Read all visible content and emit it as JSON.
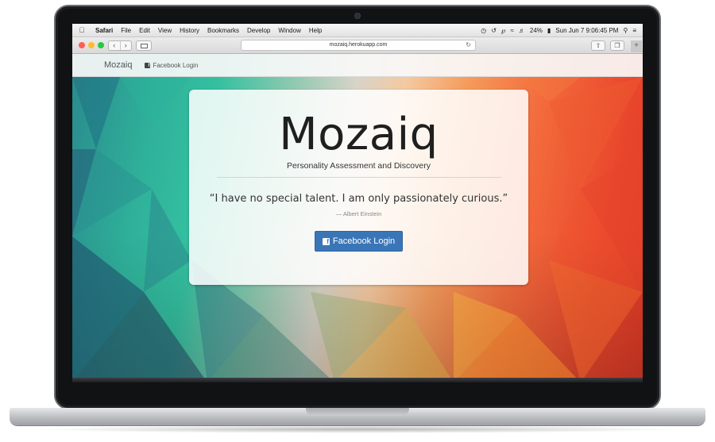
{
  "menubar": {
    "items": [
      "Safari",
      "File",
      "Edit",
      "View",
      "History",
      "Bookmarks",
      "Develop",
      "Window",
      "Help"
    ],
    "battery": "24%",
    "datetime": "Sun Jun 7  9:06:45 PM"
  },
  "browser": {
    "url": "mozaiq.herokuapp.com"
  },
  "site": {
    "brand": "Mozaiq",
    "nav_login": "Facebook Login",
    "title": "Mozaiq",
    "subtitle": "Personality Assessment and Discovery",
    "quote": "“I have no special talent. I am only passionately curious.”",
    "attribution": "— Albert Einstein",
    "login_button": "Facebook Login"
  },
  "colors": {
    "button_blue": "#3a76b7",
    "teal": "#34c0a0",
    "orange": "#f36b3c",
    "red": "#de3a26"
  },
  "icons": {
    "apple": "apple-logo",
    "facebook": "facebook-icon",
    "reload": "reload-icon",
    "share": "share-icon",
    "tabs": "tabs-icon"
  }
}
